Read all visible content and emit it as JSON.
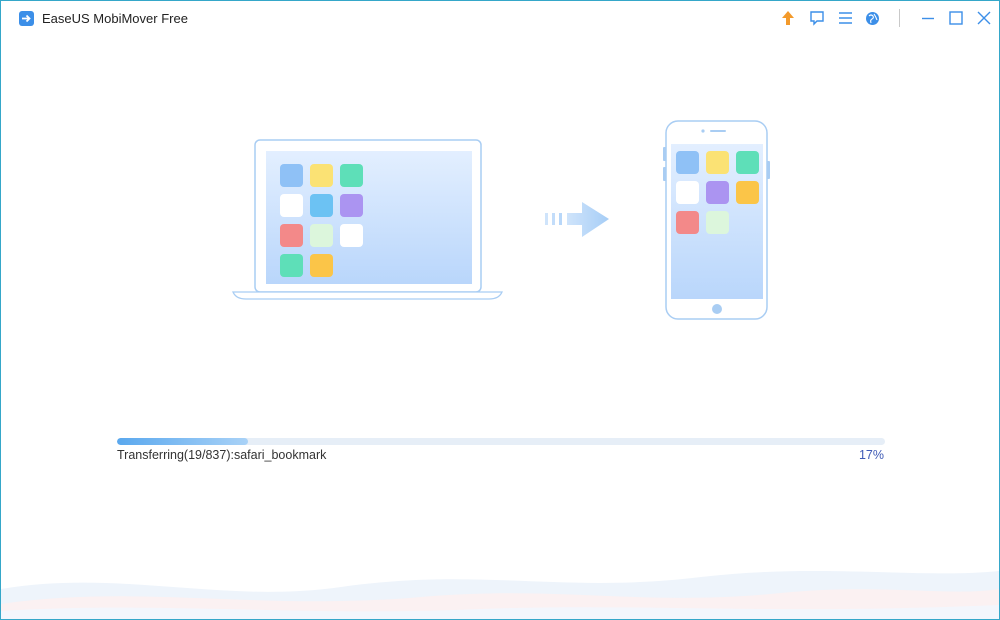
{
  "window": {
    "title": "EaseUS MobiMover Free"
  },
  "titlebar": {
    "icons": [
      "upgrade-arrow-icon",
      "feedback-icon",
      "menu-icon",
      "language-globe-icon",
      "minimize-icon",
      "maximize-icon",
      "close-icon"
    ]
  },
  "colors": {
    "accent": "#3c8fe8",
    "window_border": "#35a7c9",
    "upgrade_arrow": "#f39a2b",
    "progress_fill": "#5aa8ee",
    "progress_track": "#e6eef7",
    "percent_text": "#3f5bb6"
  },
  "transfer": {
    "status": "Transferring(19/837):safari_bookmark",
    "percent_label": "17%",
    "progress_fraction": 0.17
  }
}
